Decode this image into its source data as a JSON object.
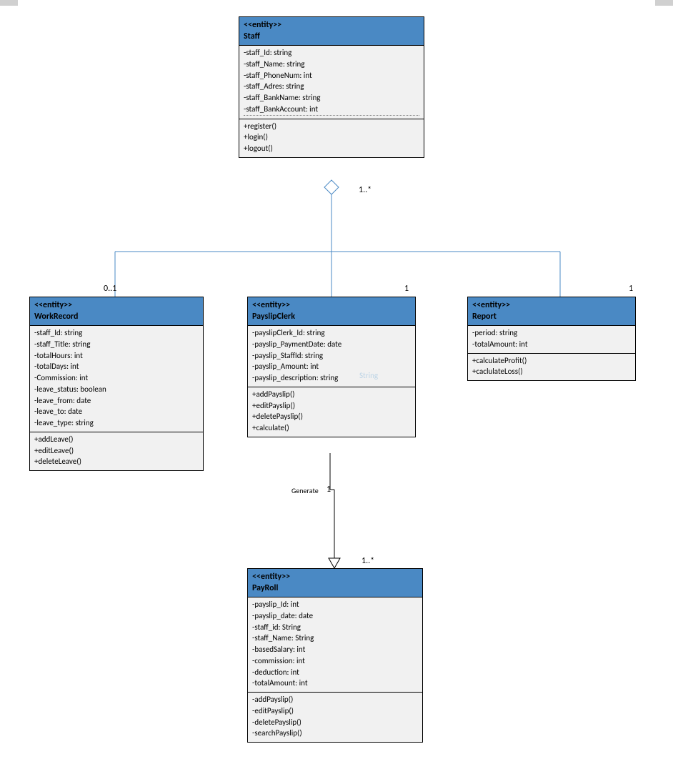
{
  "classes": {
    "staff": {
      "stereotype": "<<entity>>",
      "name": "Staff",
      "attributes": [
        "-staff_Id: string",
        "-staff_Name: string",
        "-staff_PhoneNum: int",
        "-staff_Adres: string",
        "-staff_BankName: string",
        "-staff_BankAccount: int"
      ],
      "operations": [
        "+register()",
        "+login()",
        "+logout()"
      ]
    },
    "workrecord": {
      "stereotype": "<<entity>>",
      "name": "WorkRecord",
      "attributes": [
        "-staff_Id: string",
        "-staff_Title: string",
        "-totalHours: int",
        "-totalDays: int",
        "-Commission: int",
        "-leave_status: boolean",
        "-leave_from: date",
        "-leave_to: date",
        "-leave_type: string"
      ],
      "operations": [
        "+addLeave()",
        "+editLeave()",
        "+deleteLeave()"
      ]
    },
    "payslipclerk": {
      "stereotype": "<<entity>>",
      "name": "PayslipClerk",
      "attributes": [
        "-payslipClerk_Id: string",
        "-payslip_PaymentDate: date",
        "-payslip_StaffId: string",
        "-payslip_Amount: int",
        "-payslip_description: string"
      ],
      "operations": [
        "+addPayslip()",
        "+editPayslip()",
        "+deletePayslip()",
        "+calculate()"
      ]
    },
    "report": {
      "stereotype": "<<entity>>",
      "name": "Report",
      "attributes": [
        "-period: string",
        "-totalAmount: int"
      ],
      "operations": [
        "+calculateProfit()",
        "+caclulateLoss()"
      ]
    },
    "payroll": {
      "stereotype": "<<entity>>",
      "name": "PayRoll",
      "attributes": [
        "-payslip_Id: int",
        "-payslip_date: date",
        "-staff_id: String",
        "-staff_Name: String",
        "-basedSalary: int",
        "-commission: int",
        "-deduction: int",
        "-totalAmount: int"
      ],
      "operations": [
        "-addPayslip()",
        "-editPayslip()",
        "-deletePayslip()",
        "-searchPayslip()"
      ]
    }
  },
  "labels": {
    "staff_mult": "1..*",
    "workrecord_mult": "0..1",
    "payslipclerk_mult": "1",
    "report_mult": "1",
    "generate_label": "Generate",
    "generate_mult_top": "1",
    "generate_mult_bottom": "1..*"
  },
  "watermark": "String"
}
